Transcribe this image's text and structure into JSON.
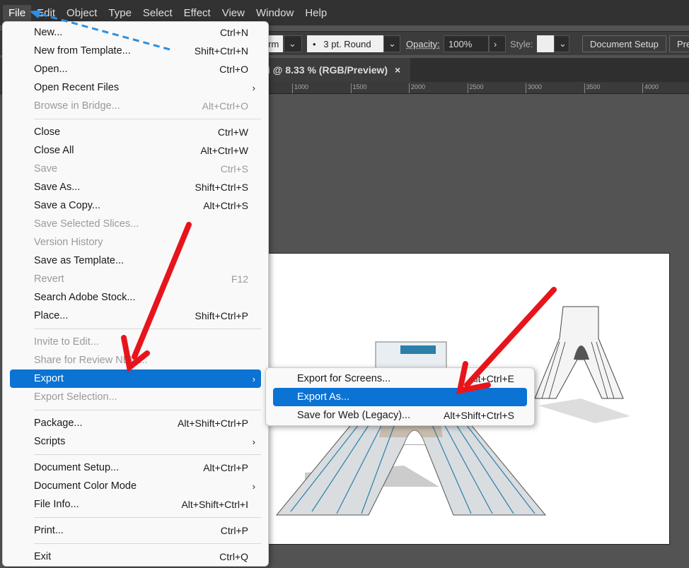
{
  "menubar": [
    "File",
    "Edit",
    "Object",
    "Type",
    "Select",
    "Effect",
    "View",
    "Window",
    "Help"
  ],
  "toolbar": {
    "brush_partial": "orm",
    "stroke": "3 pt. Round",
    "opacity_label": "Opacity:",
    "opacity": "100%",
    "style_label": "Style:",
    "document_setup": "Document Setup",
    "preferences_partial": "Pre"
  },
  "document_tab": {
    "title": "i @ 8.33 % (RGB/Preview)",
    "close": "×"
  },
  "ruler": [
    "1000",
    "1500",
    "2000",
    "2500",
    "3000",
    "3500",
    "4000"
  ],
  "file_menu": [
    {
      "label": "New...",
      "shortcut": "Ctrl+N"
    },
    {
      "label": "New from Template...",
      "shortcut": "Shift+Ctrl+N"
    },
    {
      "label": "Open...",
      "shortcut": "Ctrl+O"
    },
    {
      "label": "Open Recent Files",
      "submenu": true
    },
    {
      "label": "Browse in Bridge...",
      "shortcut": "Alt+Ctrl+O",
      "disabled": true
    },
    {
      "sep": true
    },
    {
      "label": "Close",
      "shortcut": "Ctrl+W"
    },
    {
      "label": "Close All",
      "shortcut": "Alt+Ctrl+W"
    },
    {
      "label": "Save",
      "shortcut": "Ctrl+S",
      "disabled": true
    },
    {
      "label": "Save As...",
      "shortcut": "Shift+Ctrl+S"
    },
    {
      "label": "Save a Copy...",
      "shortcut": "Alt+Ctrl+S"
    },
    {
      "label": "Save Selected Slices...",
      "disabled": true
    },
    {
      "label": "Version History",
      "disabled": true
    },
    {
      "label": "Save as Template..."
    },
    {
      "label": "Revert",
      "shortcut": "F12",
      "disabled": true
    },
    {
      "label": "Search Adobe Stock..."
    },
    {
      "label": "Place...",
      "shortcut": "Shift+Ctrl+P"
    },
    {
      "sep": true
    },
    {
      "label": "Invite to Edit...",
      "disabled": true
    },
    {
      "label": "Share for Review NEW...",
      "disabled": true
    },
    {
      "label": "Export",
      "submenu": true,
      "highlighted": true
    },
    {
      "label": "Export Selection...",
      "disabled": true
    },
    {
      "sep": true
    },
    {
      "label": "Package...",
      "shortcut": "Alt+Shift+Ctrl+P"
    },
    {
      "label": "Scripts",
      "submenu": true
    },
    {
      "sep": true
    },
    {
      "label": "Document Setup...",
      "shortcut": "Alt+Ctrl+P"
    },
    {
      "label": "Document Color Mode",
      "submenu": true
    },
    {
      "label": "File Info...",
      "shortcut": "Alt+Shift+Ctrl+I"
    },
    {
      "sep": true
    },
    {
      "label": "Print...",
      "shortcut": "Ctrl+P"
    },
    {
      "sep": true
    },
    {
      "label": "Exit",
      "shortcut": "Ctrl+Q"
    }
  ],
  "export_submenu": [
    {
      "label": "Export for Screens...",
      "shortcut": "Alt+Ctrl+E"
    },
    {
      "label": "Export As...",
      "highlighted": true
    },
    {
      "label": "Save for Web (Legacy)...",
      "shortcut": "Alt+Shift+Ctrl+S"
    }
  ],
  "colors": {
    "highlight": "#0a73d4",
    "annotation_arrow": "#e8141b",
    "annotation_dashed": "#2d8fe0"
  }
}
